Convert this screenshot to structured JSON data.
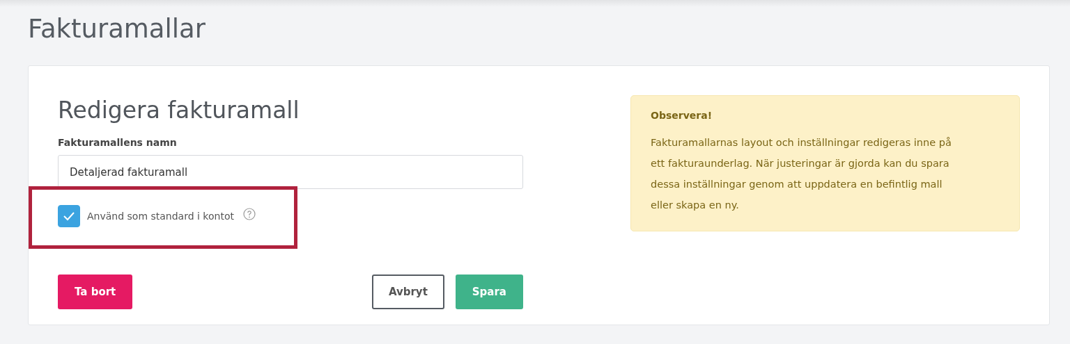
{
  "page": {
    "title": "Fakturamallar"
  },
  "form": {
    "heading": "Redigera fakturamall",
    "name_field": {
      "label": "Fakturamallens namn",
      "value": "Detaljerad fakturamall"
    },
    "default_checkbox": {
      "label": "Använd som standard i kontot",
      "checked": true
    },
    "buttons": [
      {
        "kind": "danger",
        "label": "Ta bort"
      },
      {
        "kind": "outline",
        "label": "Avbryt"
      },
      {
        "kind": "primary",
        "label": "Spara"
      }
    ]
  },
  "notice": {
    "title": "Observera!",
    "text": "Fakturamallarnas layout och inställningar redigeras inne på ett fakturaunderlag. När justeringar är gjorda kan du spara dessa inställningar genom att uppdatera en befintlig mall eller skapa en ny."
  }
}
